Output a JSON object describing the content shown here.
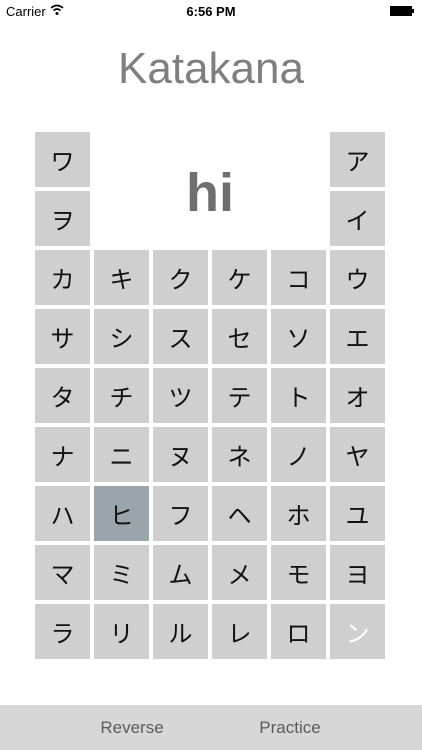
{
  "status": {
    "carrier": "Carrier",
    "time": "6:56 PM"
  },
  "title": "Katakana",
  "romaji": "hi",
  "grid": {
    "top_pairs": [
      {
        "left": "ワ",
        "right": "ア"
      },
      {
        "left": "ヲ",
        "right": "イ"
      }
    ],
    "rows": [
      [
        "カ",
        "キ",
        "ク",
        "ケ",
        "コ",
        "ウ"
      ],
      [
        "サ",
        "シ",
        "ス",
        "セ",
        "ソ",
        "エ"
      ],
      [
        "タ",
        "チ",
        "ツ",
        "テ",
        "ト",
        "オ"
      ],
      [
        "ナ",
        "ニ",
        "ヌ",
        "ネ",
        "ノ",
        "ヤ"
      ],
      [
        "ハ",
        "ヒ",
        "フ",
        "ヘ",
        "ホ",
        "ユ"
      ],
      [
        "マ",
        "ミ",
        "ム",
        "メ",
        "モ",
        "ヨ"
      ],
      [
        "ラ",
        "リ",
        "ル",
        "レ",
        "ロ",
        "ン"
      ]
    ],
    "selected": "ヒ",
    "faded": "ン"
  },
  "toolbar": {
    "reverse_label": "Reverse",
    "practice_label": "Practice"
  },
  "colors": {
    "cell": "#cfcfcf",
    "selected_cell": "#9aa4ab",
    "title": "#7f7f7f",
    "toolbar": "#d7d7d7"
  }
}
